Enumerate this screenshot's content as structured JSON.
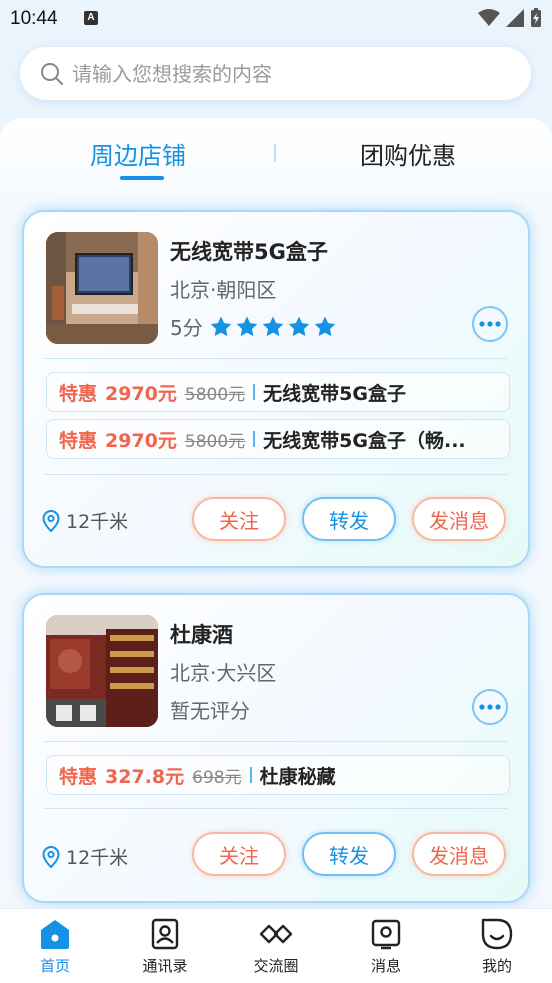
{
  "status": {
    "time": "10:44",
    "notif_letter": "A"
  },
  "search": {
    "placeholder": "请输入您想搜索的内容"
  },
  "tabs": [
    {
      "label": "周边店铺",
      "active": true
    },
    {
      "label": "团购优惠",
      "active": false
    }
  ],
  "stores": [
    {
      "name": "无线宽带5G盒子",
      "location": "北京·朝阳区",
      "rating_text": "5分",
      "stars": 5,
      "deals": [
        {
          "tag": "特惠",
          "price": "2970元",
          "old_price": "5800元",
          "name": "无线宽带5G盒子"
        },
        {
          "tag": "特惠",
          "price": "2970元",
          "old_price": "5800元",
          "name": "无线宽带5G盒子（畅..."
        }
      ],
      "distance": "12千米",
      "buttons": {
        "follow": "关注",
        "share": "转发",
        "message": "发消息"
      }
    },
    {
      "name": "杜康酒",
      "location": "北京·大兴区",
      "rating_text": "暂无评分",
      "stars": 0,
      "deals": [
        {
          "tag": "特惠",
          "price": "327.8元",
          "old_price": "698元",
          "name": "杜康秘藏"
        }
      ],
      "distance": "12千米",
      "buttons": {
        "follow": "关注",
        "share": "转发",
        "message": "发消息"
      }
    }
  ],
  "nav": [
    {
      "label": "首页",
      "icon": "home-icon",
      "active": true
    },
    {
      "label": "通讯录",
      "icon": "contacts-icon",
      "active": false
    },
    {
      "label": "交流圈",
      "icon": "circle-icon",
      "active": false
    },
    {
      "label": "消息",
      "icon": "message-icon",
      "active": false
    },
    {
      "label": "我的",
      "icon": "profile-icon",
      "active": false
    }
  ],
  "colors": {
    "accent": "#1591e6",
    "deal": "#f0654d",
    "star": "#1591e6"
  }
}
